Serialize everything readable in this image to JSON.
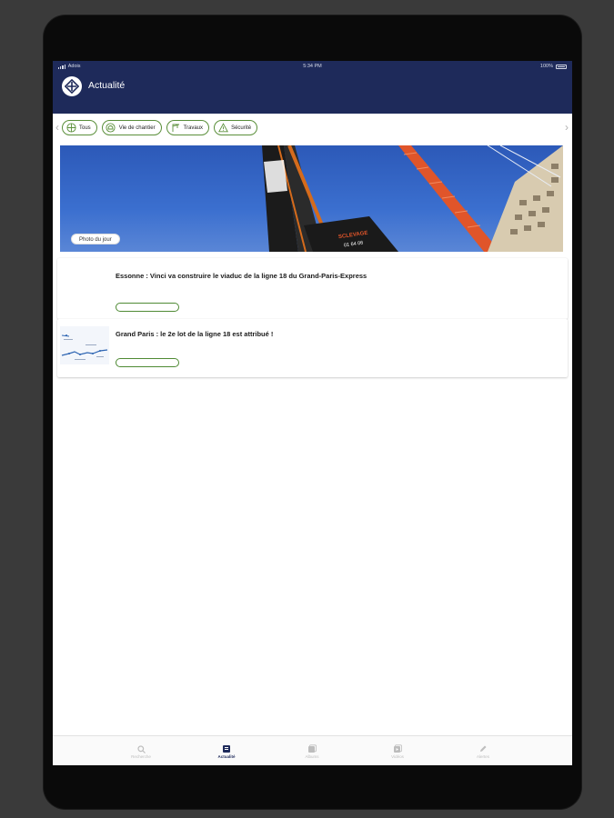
{
  "status_bar": {
    "carrier": "Adois",
    "time": "5:34 PM",
    "battery": "100%"
  },
  "header": {
    "title": "Actualité"
  },
  "filters": [
    {
      "label": "Tous",
      "icon": "grid-icon"
    },
    {
      "label": "Vie de chantier",
      "icon": "helmet-icon"
    },
    {
      "label": "Travaux",
      "icon": "crane-icon"
    },
    {
      "label": "Sécurité",
      "icon": "warning-icon"
    }
  ],
  "photo": {
    "badge": "Photo du jour",
    "sign_brand": "SCLEVAGE",
    "sign_phone": "01 64 06"
  },
  "news": [
    {
      "title": "Essonne : Vinci va construire le viaduc de la ligne 18 du Grand-Paris-Express"
    },
    {
      "title": "Grand Paris : le 2e lot de la ligne 18 est attribué !"
    }
  ],
  "tabs": [
    {
      "label": "Recherche",
      "icon": "search-icon",
      "active": false
    },
    {
      "label": "Actualité",
      "icon": "news-icon",
      "active": true
    },
    {
      "label": "Albums",
      "icon": "album-icon",
      "active": false
    },
    {
      "label": "Vidéos",
      "icon": "video-icon",
      "active": false
    },
    {
      "label": "Alertes",
      "icon": "pencil-icon",
      "active": false
    }
  ],
  "colors": {
    "header_bg": "#1e2a5a",
    "accent_green": "#5a8f3a",
    "sky": "#2c59b8",
    "crane_orange": "#e0552a"
  }
}
